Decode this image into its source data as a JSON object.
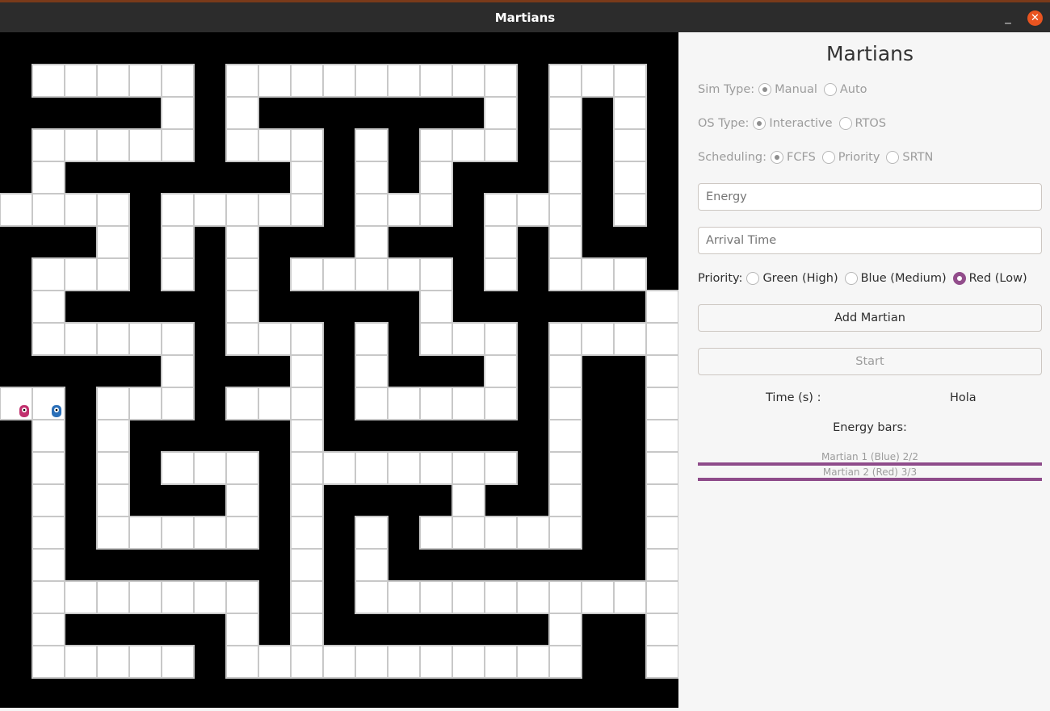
{
  "window": {
    "title": "Martians",
    "minimize_glyph": "_",
    "close_glyph": "✕"
  },
  "maze": {
    "wall_color": "#000000",
    "path_color": "#ffffff",
    "grid_color": "#c8c8c8",
    "martians": [
      {
        "name": "Martian 1 (Blue)",
        "color": "#2a6fb8",
        "icon": "martian-icon"
      },
      {
        "name": "Martian 2 (Red)",
        "color": "#c1306e",
        "icon": "martian-icon"
      }
    ]
  },
  "panel": {
    "heading": "Martians",
    "sim_type": {
      "label": "Sim Type:",
      "options": [
        "Manual",
        "Auto"
      ],
      "selected": "Manual"
    },
    "os_type": {
      "label": "OS Type:",
      "options": [
        "Interactive",
        "RTOS"
      ],
      "selected": "Interactive"
    },
    "scheduling": {
      "label": "Scheduling:",
      "options": [
        "FCFS",
        "Priority",
        "SRTN"
      ],
      "selected": "FCFS"
    },
    "energy_placeholder": "Energy",
    "arrival_placeholder": "Arrival Time",
    "priority": {
      "label": "Priority:",
      "options": [
        "Green (High)",
        "Blue (Medium)",
        "Red (Low)"
      ],
      "selected": "Red (Low)"
    },
    "add_button": "Add Martian",
    "start_button": "Start",
    "time_label": "Time (s) :",
    "time_value": "Hola",
    "energy_bars_label": "Energy bars:",
    "energy_bars": [
      {
        "label": "Martian 1 (Blue) 2/2",
        "current": 2,
        "max": 2
      },
      {
        "label": "Martian 2 (Red) 3/3",
        "current": 3,
        "max": 3
      }
    ],
    "accent_color": "#924d8b"
  }
}
